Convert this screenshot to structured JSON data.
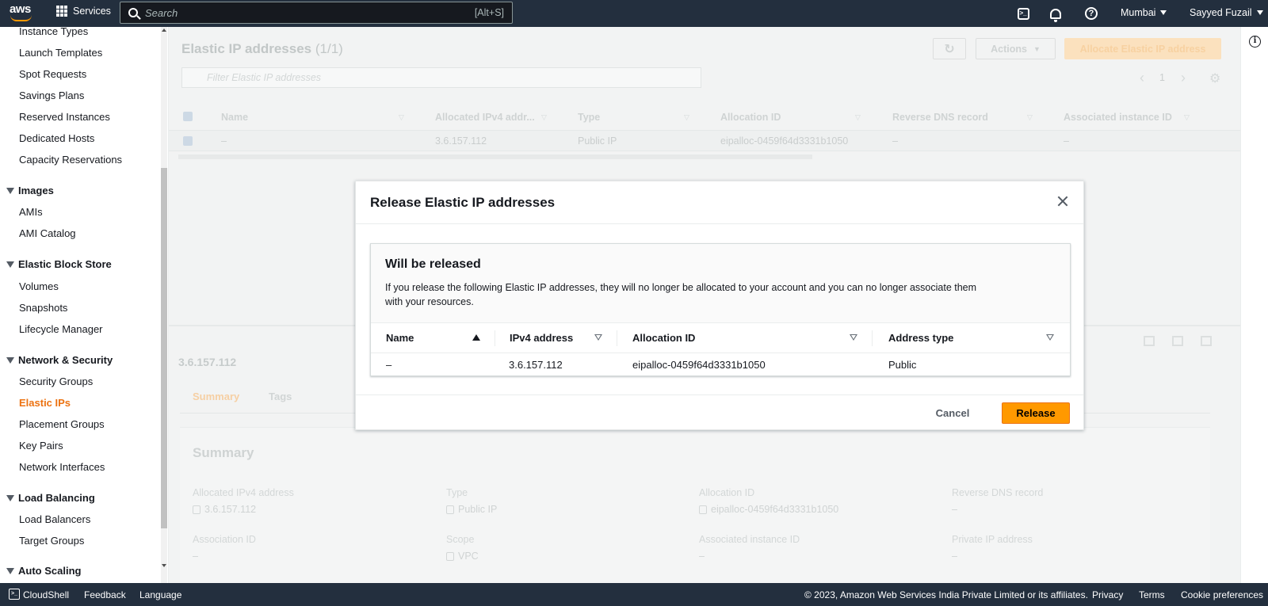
{
  "topnav": {
    "logo_text": "aws",
    "services_label": "Services",
    "search_placeholder": "Search",
    "search_shortcut": "[Alt+S]",
    "region": "Mumbai",
    "user": "Sayyed Fuzail"
  },
  "sidebar": {
    "items": [
      {
        "label": "Instance Types"
      },
      {
        "label": "Launch Templates"
      },
      {
        "label": "Spot Requests"
      },
      {
        "label": "Savings Plans"
      },
      {
        "label": "Reserved Instances"
      },
      {
        "label": "Dedicated Hosts"
      },
      {
        "label": "Capacity Reservations"
      }
    ],
    "images_section": "Images",
    "images_items": [
      "AMIs",
      "AMI Catalog"
    ],
    "ebs_section": "Elastic Block Store",
    "ebs_items": [
      "Volumes",
      "Snapshots",
      "Lifecycle Manager"
    ],
    "netsec_section": "Network & Security",
    "netsec_items": [
      "Security Groups",
      "Elastic IPs",
      "Placement Groups",
      "Key Pairs",
      "Network Interfaces"
    ],
    "lb_section": "Load Balancing",
    "lb_items": [
      "Load Balancers",
      "Target Groups"
    ],
    "autoscaling_section": "Auto Scaling"
  },
  "main": {
    "title": "Elastic IP addresses",
    "count": "(1/1)",
    "actions_label": "Actions",
    "allocate_label": "Allocate Elastic IP address",
    "filter_placeholder": "Filter Elastic IP addresses",
    "page_number": "1",
    "columns": [
      "Name",
      "Allocated IPv4 addr...",
      "Type",
      "Allocation ID",
      "Reverse DNS record",
      "Associated instance ID"
    ],
    "row": {
      "name": "–",
      "ipv4": "3.6.157.112",
      "type": "Public IP",
      "allocation_id": "eipalloc-0459f64d3331b1050",
      "reverse_dns": "–",
      "instance_id": "–"
    },
    "detail_title": "3.6.157.112",
    "tabs": [
      "Summary",
      "Tags"
    ],
    "summary_heading": "Summary",
    "summary": {
      "allocated_ipv4_label": "Allocated IPv4 address",
      "allocated_ipv4_value": "3.6.157.112",
      "type_label": "Type",
      "type_value": "Public IP",
      "allocation_id_label": "Allocation ID",
      "allocation_id_value": "eipalloc-0459f64d3331b1050",
      "reverse_dns_label": "Reverse DNS record",
      "reverse_dns_value": "–",
      "association_id_label": "Association ID",
      "association_id_value": "–",
      "scope_label": "Scope",
      "scope_value": "VPC",
      "assoc_instance_label": "Associated instance ID",
      "assoc_instance_value": "–",
      "private_ip_label": "Private IP address",
      "private_ip_value": "–"
    }
  },
  "modal": {
    "title": "Release Elastic IP addresses",
    "section_heading": "Will be released",
    "description": "If you release the following Elastic IP addresses, they will no longer be allocated to your account and you can no longer associate them with your resources.",
    "columns": [
      "Name",
      "IPv4 address",
      "Allocation ID",
      "Address type"
    ],
    "rows": [
      {
        "name": "–",
        "ipv4": "3.6.157.112",
        "allocation_id": "eipalloc-0459f64d3331b1050",
        "address_type": "Public"
      }
    ],
    "cancel_label": "Cancel",
    "release_label": "Release"
  },
  "footer": {
    "cloudshell": "CloudShell",
    "feedback": "Feedback",
    "language": "Language",
    "copyright": "© 2023, Amazon Web Services India Private Limited or its affiliates.",
    "privacy": "Privacy",
    "terms": "Terms",
    "cookie": "Cookie preferences"
  },
  "colors": {
    "nav_bg": "#232f3e",
    "accent_orange": "#ec7211",
    "release_button": "#ff9900"
  }
}
